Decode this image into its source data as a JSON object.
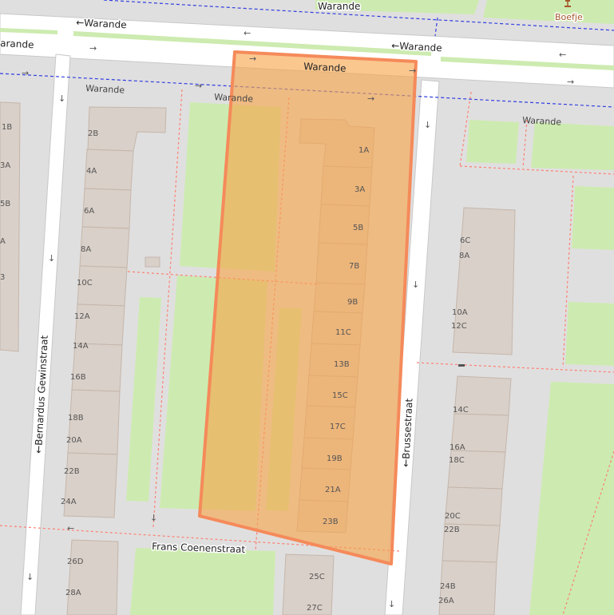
{
  "streets": {
    "warande": "Warande",
    "warande_arrow": "←Warande",
    "bernardus": "←Bernardus Gewinstraat",
    "brussestraat": "←Brussestraat",
    "frans": "Frans Coenenstraat",
    "left_partial": "arande"
  },
  "poi": {
    "boefje": "Boefje"
  },
  "house_numbers": {
    "left_col": [
      "2B",
      "4A",
      "6A",
      "8A",
      "10C",
      "12A",
      "14A",
      "16B",
      "18B",
      "20A",
      "22B",
      "24A"
    ],
    "edge_col": [
      "1B",
      "3A",
      "5B",
      "A",
      "3"
    ],
    "mid_col": [
      "1A",
      "3A",
      "5B",
      "7B",
      "9B",
      "11C",
      "13B",
      "15C",
      "17C",
      "19B",
      "21A",
      "23B"
    ],
    "right_col": [
      "6C",
      "8A",
      "10A",
      "12C",
      "14C",
      "16A",
      "18C",
      "20C",
      "22B",
      "24B",
      "26A"
    ],
    "bottom_left": [
      "26D",
      "28A"
    ],
    "bottom_mid": [
      "25C",
      "27C"
    ]
  },
  "colors": {
    "background": "#e0dfdf",
    "road": "#ffffff",
    "road_edge": "#c8c8c8",
    "building": "#d9d0c9",
    "building_stroke": "#c4b6ab",
    "grass": "#cdebb0",
    "footpath": "#fa8072",
    "bus_route": "#2f3fe0",
    "selection_fill": "#f7a54a",
    "selection_stroke": "#f58a5a"
  },
  "arrows": {
    "left": "←",
    "right": "→",
    "down": "↓"
  },
  "icons": [
    "playground-icon"
  ]
}
